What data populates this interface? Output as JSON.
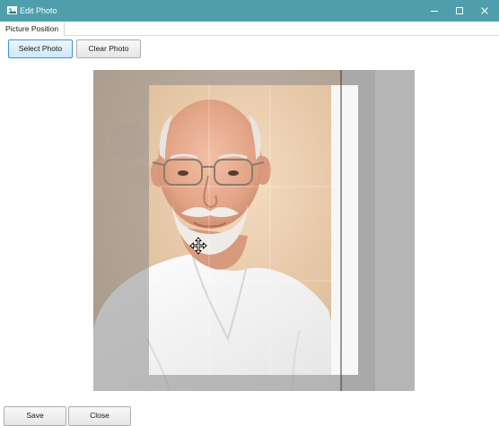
{
  "window": {
    "title": "Edit Photo",
    "title_icon": "photo-edit-icon",
    "controls": {
      "minimize": "minimize-icon",
      "maximize": "maximize-icon",
      "close": "close-icon"
    },
    "accent_color": "#4e9fab"
  },
  "tabs": [
    {
      "label": "Picture Position",
      "active": true
    }
  ],
  "toolbar": {
    "select_label": "Select Photo",
    "clear_label": "Clear Photo"
  },
  "editor": {
    "cursor_icon": "move-cursor-icon",
    "grid": true
  },
  "footer": {
    "save_label": "Save",
    "close_label": "Close"
  }
}
